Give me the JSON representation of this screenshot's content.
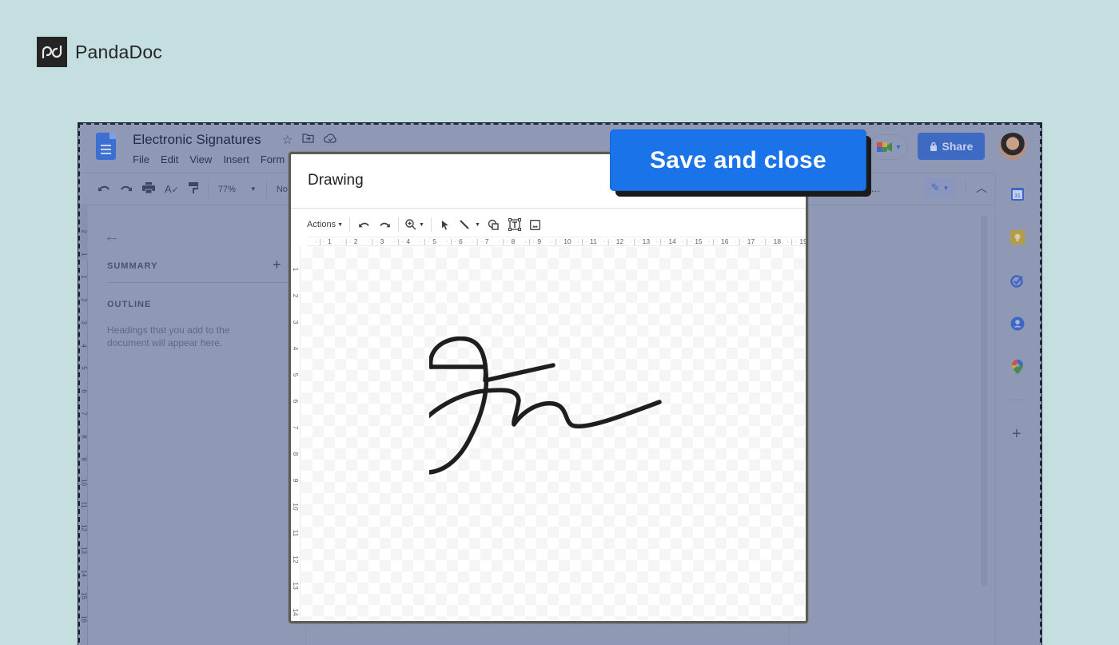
{
  "brand": {
    "name": "PandaDoc",
    "logo_icon": "pandadoc-logo-icon"
  },
  "doc": {
    "title": "Electronic Signatures",
    "title_icons": [
      "star-icon",
      "move-to-folder-icon",
      "cloud-saved-icon"
    ],
    "menu": [
      "File",
      "Edit",
      "View",
      "Insert",
      "Form"
    ],
    "share_label": "Share",
    "toolbar": {
      "zoom": "77%",
      "style": "Nor",
      "overflow": "..."
    }
  },
  "outline": {
    "summary_label": "SUMMARY",
    "outline_label": "OUTLINE",
    "hint": "Headings that you add to the document will appear here."
  },
  "left_ruler": [
    "2",
    "1",
    "1",
    "2",
    "3",
    "4",
    "5",
    "6",
    "7",
    "8",
    "9",
    "10",
    "11",
    "12",
    "13",
    "14",
    "15",
    "16"
  ],
  "side_panel": [
    "calendar-icon",
    "keep-icon",
    "tasks-icon",
    "contacts-icon",
    "maps-icon"
  ],
  "side_panel_calendar_text": "31",
  "drawing": {
    "title": "Drawing",
    "actions_label": "Actions",
    "h_ruler": [
      "1",
      "2",
      "3",
      "4",
      "5",
      "6",
      "7",
      "8",
      "9",
      "10",
      "11",
      "12",
      "13",
      "14",
      "15",
      "16",
      "17",
      "18",
      "19"
    ],
    "v_ruler": [
      "1",
      "2",
      "3",
      "4",
      "5",
      "6",
      "7",
      "8",
      "9",
      "10",
      "11",
      "12",
      "13",
      "14"
    ]
  },
  "save_button": {
    "label": "Save and close",
    "color": "#1a73e8"
  }
}
